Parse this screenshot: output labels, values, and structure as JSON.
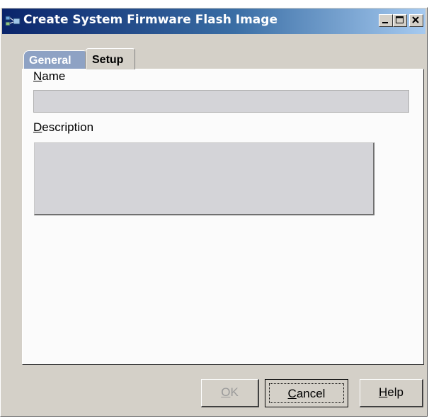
{
  "window": {
    "title": "Create System Firmware Flash Image"
  },
  "titlebar_buttons": {
    "minimize_icon": "minimize-icon",
    "maximize_icon": "maximize-icon",
    "close_icon": "close-icon"
  },
  "tabs": [
    {
      "label": "General",
      "active": false
    },
    {
      "label": "Setup",
      "active": true
    }
  ],
  "form": {
    "name_label_mnemonic": "N",
    "name_label_rest": "ame",
    "name_value": "",
    "description_label_mnemonic": "D",
    "description_label_rest": "escription",
    "description_value": ""
  },
  "buttons": {
    "ok_mnemonic": "O",
    "ok_rest": "K",
    "ok_enabled": false,
    "cancel_mnemonic": "C",
    "cancel_rest": "ancel",
    "help_mnemonic": "H",
    "help_rest": "elp"
  },
  "colors": {
    "titlebar_start": "#0a246a",
    "titlebar_end": "#a6caf0",
    "dialog_background": "#d4d0c8"
  }
}
